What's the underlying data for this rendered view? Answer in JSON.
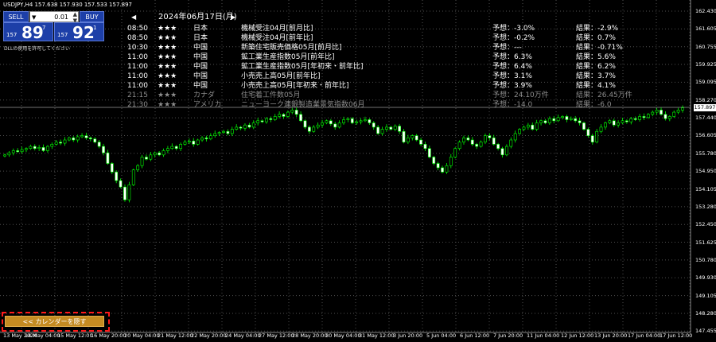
{
  "symbol_info": "USDJPY,H4  157.638 157.930 157.533 157.897",
  "trade_panel": {
    "sell_label": "SELL",
    "buy_label": "BUY",
    "lot_value": "0.01",
    "bid": {
      "prefix": "157",
      "big": "89",
      "sup": "7"
    },
    "ask": {
      "prefix": "157",
      "big": "92",
      "sup": "1"
    }
  },
  "disclaimer": "DLLの使用を許可してください",
  "calendar": {
    "prev_icon": "triangle-left-icon",
    "next_icon": "triangle-right-icon",
    "date": "2024年06月17日(月)",
    "rows": [
      {
        "time": "08:50",
        "stars": "★★★",
        "country": "日本",
        "event": "機械受注04月[前月比]",
        "forecast": "予想：-3.0%",
        "result": "結果：-2.9%",
        "dim": false
      },
      {
        "time": "08:50",
        "stars": "★★★",
        "country": "日本",
        "event": "機械受注04月[前年比]",
        "forecast": "予想：-0.2%",
        "result": "結果：0.7%",
        "dim": false
      },
      {
        "time": "10:30",
        "stars": "★★★",
        "country": "中国",
        "event": "新築住宅販売価格05月[前月比]",
        "forecast": "予想：---",
        "result": "結果：-0.71%",
        "dim": false
      },
      {
        "time": "11:00",
        "stars": "★★★",
        "country": "中国",
        "event": "鉱工業生産指数05月[前年比]",
        "forecast": "予想：6.3%",
        "result": "結果：5.6%",
        "dim": false
      },
      {
        "time": "11:00",
        "stars": "★★★",
        "country": "中国",
        "event": "鉱工業生産指数05月[年初来・前年比]",
        "forecast": "予想：6.4%",
        "result": "結果：6.2%",
        "dim": false
      },
      {
        "time": "11:00",
        "stars": "★★★",
        "country": "中国",
        "event": "小売売上高05月[前年比]",
        "forecast": "予想：3.1%",
        "result": "結果：3.7%",
        "dim": false
      },
      {
        "time": "11:00",
        "stars": "★★★",
        "country": "中国",
        "event": "小売売上高05月[年初来・前年比]",
        "forecast": "予想：3.9%",
        "result": "結果：4.1%",
        "dim": false
      },
      {
        "time": "21:15",
        "stars": "★★★",
        "country": "カナダ",
        "event": "住宅着工件数05月",
        "forecast": "予想：24.10万件",
        "result": "結果：26.45万件",
        "dim": true
      },
      {
        "time": "21:30",
        "stars": "★★★",
        "country": "アメリカ",
        "event": "ニューヨーク連銀製造業景気指数06月",
        "forecast": "予想：-14.0",
        "result": "結果：-6.0",
        "dim": true
      }
    ]
  },
  "price_axis": [
    "162.430",
    "161.605",
    "160.755",
    "159.925",
    "159.095",
    "158.270",
    "157.440",
    "156.605",
    "155.780",
    "154.950",
    "154.105",
    "153.280",
    "152.450",
    "151.625",
    "150.780",
    "149.930",
    "149.105",
    "148.280",
    "147.455"
  ],
  "current_price": "157.897",
  "time_axis": [
    "13 May 2024",
    "14 May 04:00",
    "15 May 12:00",
    "16 May 20:00",
    "20 May 04:00",
    "21 May 12:00",
    "22 May 20:00",
    "24 May 04:00",
    "27 May 12:00",
    "28 May 20:00",
    "30 May 04:00",
    "31 May 12:00",
    "3 Jun 20:00",
    "5 Jun 04:00",
    "6 Jun 12:00",
    "7 Jun 20:00",
    "11 Jun 04:00",
    "12 Jun 12:00",
    "13 Jun 20:00",
    "17 Jun 04:00",
    "17 Jun 12:00"
  ],
  "hide_calendar_label": "<<  カレンダーを隠す",
  "colors": {
    "bull": "#00ff00",
    "bear": "#ffffff",
    "grid": "#505050",
    "background": "#000000",
    "button": "#c48b22",
    "highlight": "#ff1a1a"
  },
  "chart_data": {
    "type": "candlestick",
    "symbol": "USDJPY",
    "timeframe": "H4",
    "ylim": [
      147.455,
      162.43
    ],
    "close_series": [
      155.7,
      155.8,
      155.9,
      155.85,
      155.95,
      156.0,
      156.1,
      156.0,
      156.05,
      155.9,
      156.1,
      156.2,
      156.3,
      156.25,
      156.4,
      156.5,
      156.4,
      156.55,
      156.6,
      156.5,
      156.45,
      156.3,
      156.1,
      155.8,
      155.3,
      154.9,
      154.5,
      154.2,
      153.6,
      154.3,
      155.0,
      155.2,
      155.6,
      155.5,
      155.7,
      155.8,
      155.7,
      155.9,
      156.0,
      156.1,
      156.0,
      156.2,
      156.3,
      156.35,
      156.2,
      156.4,
      156.5,
      156.45,
      156.6,
      156.7,
      156.75,
      156.8,
      156.7,
      156.9,
      157.0,
      156.95,
      157.1,
      157.0,
      157.2,
      157.3,
      157.25,
      157.4,
      157.35,
      157.5,
      157.6,
      157.5,
      157.7,
      157.8,
      157.6,
      157.3,
      157.0,
      156.8,
      157.0,
      157.1,
      157.2,
      157.3,
      157.15,
      157.0,
      157.2,
      157.35,
      157.4,
      157.2,
      157.25,
      157.3,
      157.35,
      157.2,
      157.0,
      156.7,
      156.9,
      157.0,
      156.9,
      157.05,
      156.8,
      156.3,
      156.5,
      156.6,
      156.4,
      156.2,
      156.0,
      155.6,
      155.3,
      155.1,
      154.9,
      155.2,
      155.6,
      156.0,
      156.3,
      156.5,
      156.4,
      156.2,
      156.1,
      156.3,
      156.6,
      156.5,
      156.2,
      156.0,
      155.7,
      156.1,
      156.4,
      156.7,
      156.9,
      157.0,
      157.1,
      156.9,
      157.2,
      157.3,
      157.2,
      157.4,
      157.3,
      157.45,
      157.5,
      157.35,
      157.4,
      157.3,
      157.2,
      156.9,
      156.6,
      156.3,
      156.8,
      157.0,
      157.2,
      157.3,
      157.1,
      157.2,
      157.3,
      157.25,
      157.4,
      157.35,
      157.5,
      157.45,
      157.6,
      157.7,
      157.8,
      157.6,
      157.4,
      157.5,
      157.7,
      157.8,
      157.9
    ]
  }
}
